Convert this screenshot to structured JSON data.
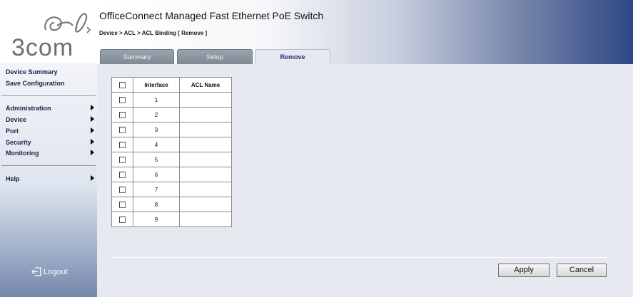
{
  "brand": {
    "logo_text": "3com",
    "logo_icon": "3com-swirl-logo"
  },
  "header": {
    "product_title": "OfficeConnect Managed Fast Ethernet PoE Switch",
    "breadcrumb": "Device > ACL > ACL Binding [ Remove ]"
  },
  "tabs": [
    {
      "label": "Summary",
      "active": false
    },
    {
      "label": "Setup",
      "active": false
    },
    {
      "label": "Remove",
      "active": true
    }
  ],
  "sidebar": {
    "links": [
      {
        "label": "Device Summary"
      },
      {
        "label": "Save Configuration"
      }
    ],
    "menus": [
      {
        "label": "Administration"
      },
      {
        "label": "Device"
      },
      {
        "label": "Port"
      },
      {
        "label": "Security"
      },
      {
        "label": "Monitoring"
      }
    ],
    "help": {
      "label": "Help"
    },
    "logout": {
      "label": "Logout",
      "icon": "logout-arrow-icon"
    }
  },
  "table": {
    "headers": {
      "interface": "Interface",
      "acl_name": "ACL Name"
    },
    "rows": [
      {
        "interface": "1",
        "acl_name": ""
      },
      {
        "interface": "2",
        "acl_name": ""
      },
      {
        "interface": "3",
        "acl_name": ""
      },
      {
        "interface": "4",
        "acl_name": ""
      },
      {
        "interface": "5",
        "acl_name": ""
      },
      {
        "interface": "6",
        "acl_name": ""
      },
      {
        "interface": "7",
        "acl_name": ""
      },
      {
        "interface": "8",
        "acl_name": ""
      },
      {
        "interface": "9",
        "acl_name": ""
      }
    ]
  },
  "buttons": {
    "apply": "Apply",
    "cancel": "Cancel"
  },
  "colors": {
    "sidebar_text": "#1a2244",
    "header_gradient_end": "#2e4785",
    "content_bg": "#e6e9f0",
    "active_tab_text": "#1b2f74"
  }
}
